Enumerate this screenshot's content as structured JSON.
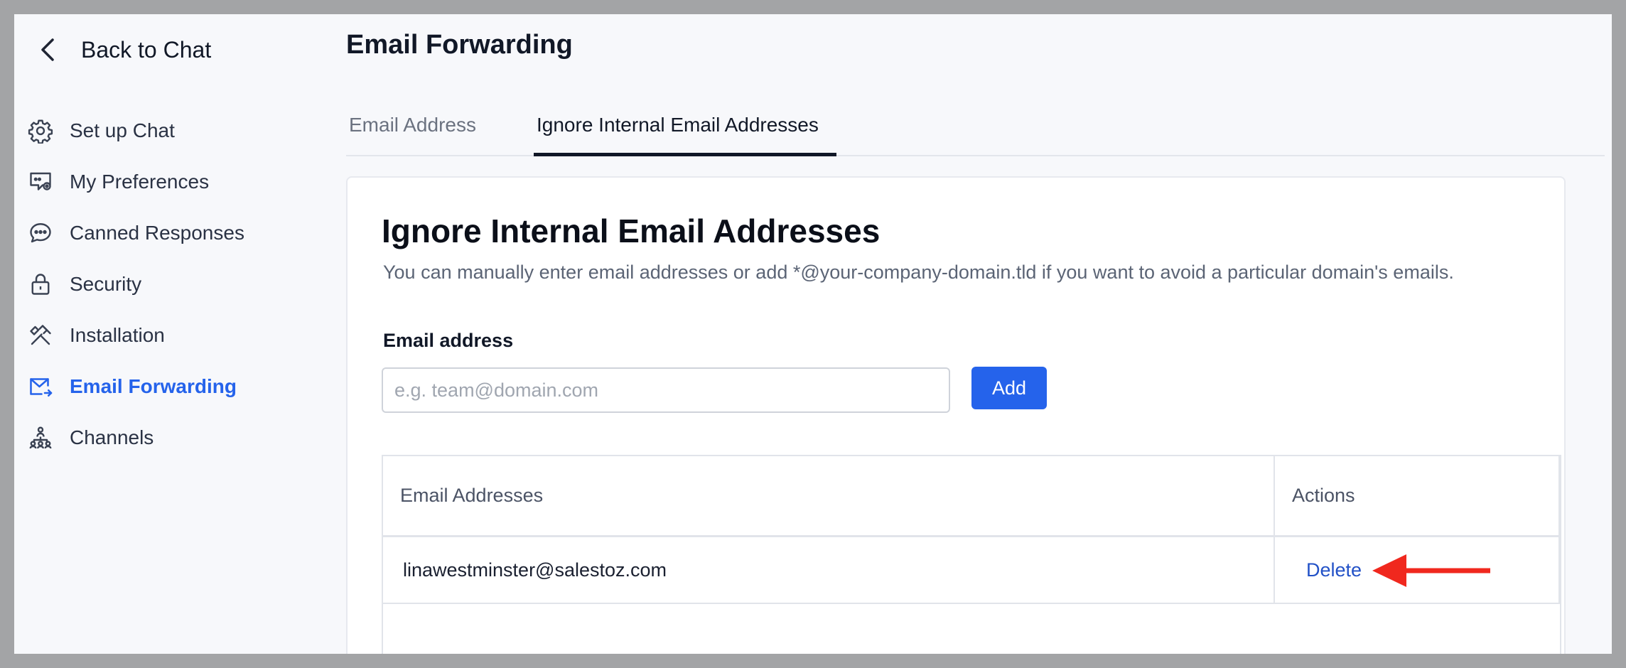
{
  "sidebar": {
    "back_label": "Back to Chat",
    "items": [
      {
        "label": "Set up Chat",
        "icon": "gear-icon"
      },
      {
        "label": "My Preferences",
        "icon": "chat-settings-icon"
      },
      {
        "label": "Canned Responses",
        "icon": "chat-bubble-icon"
      },
      {
        "label": "Security",
        "icon": "lock-icon"
      },
      {
        "label": "Installation",
        "icon": "tools-icon"
      },
      {
        "label": "Email Forwarding",
        "icon": "mail-forward-icon",
        "active": true
      },
      {
        "label": "Channels",
        "icon": "channels-icon"
      }
    ]
  },
  "main": {
    "title": "Email Forwarding",
    "tabs": [
      {
        "label": "Email Address"
      },
      {
        "label": "Ignore Internal Email Addresses",
        "active": true
      }
    ],
    "card": {
      "title": "Ignore Internal Email Addresses",
      "description": "You can manually enter email addresses or add *@your-company-domain.tld if you want to avoid a particular domain's emails.",
      "field_label": "Email address",
      "input_placeholder": "e.g. team@domain.com",
      "input_value": "",
      "add_label": "Add",
      "table": {
        "columns": [
          "Email Addresses",
          "Actions"
        ],
        "rows": [
          {
            "email": "linawestminster@salestoz.com",
            "action": "Delete"
          }
        ]
      }
    }
  },
  "colors": {
    "accent": "#2563eb",
    "link": "#2251c7",
    "annotation_arrow": "#f0281e"
  }
}
